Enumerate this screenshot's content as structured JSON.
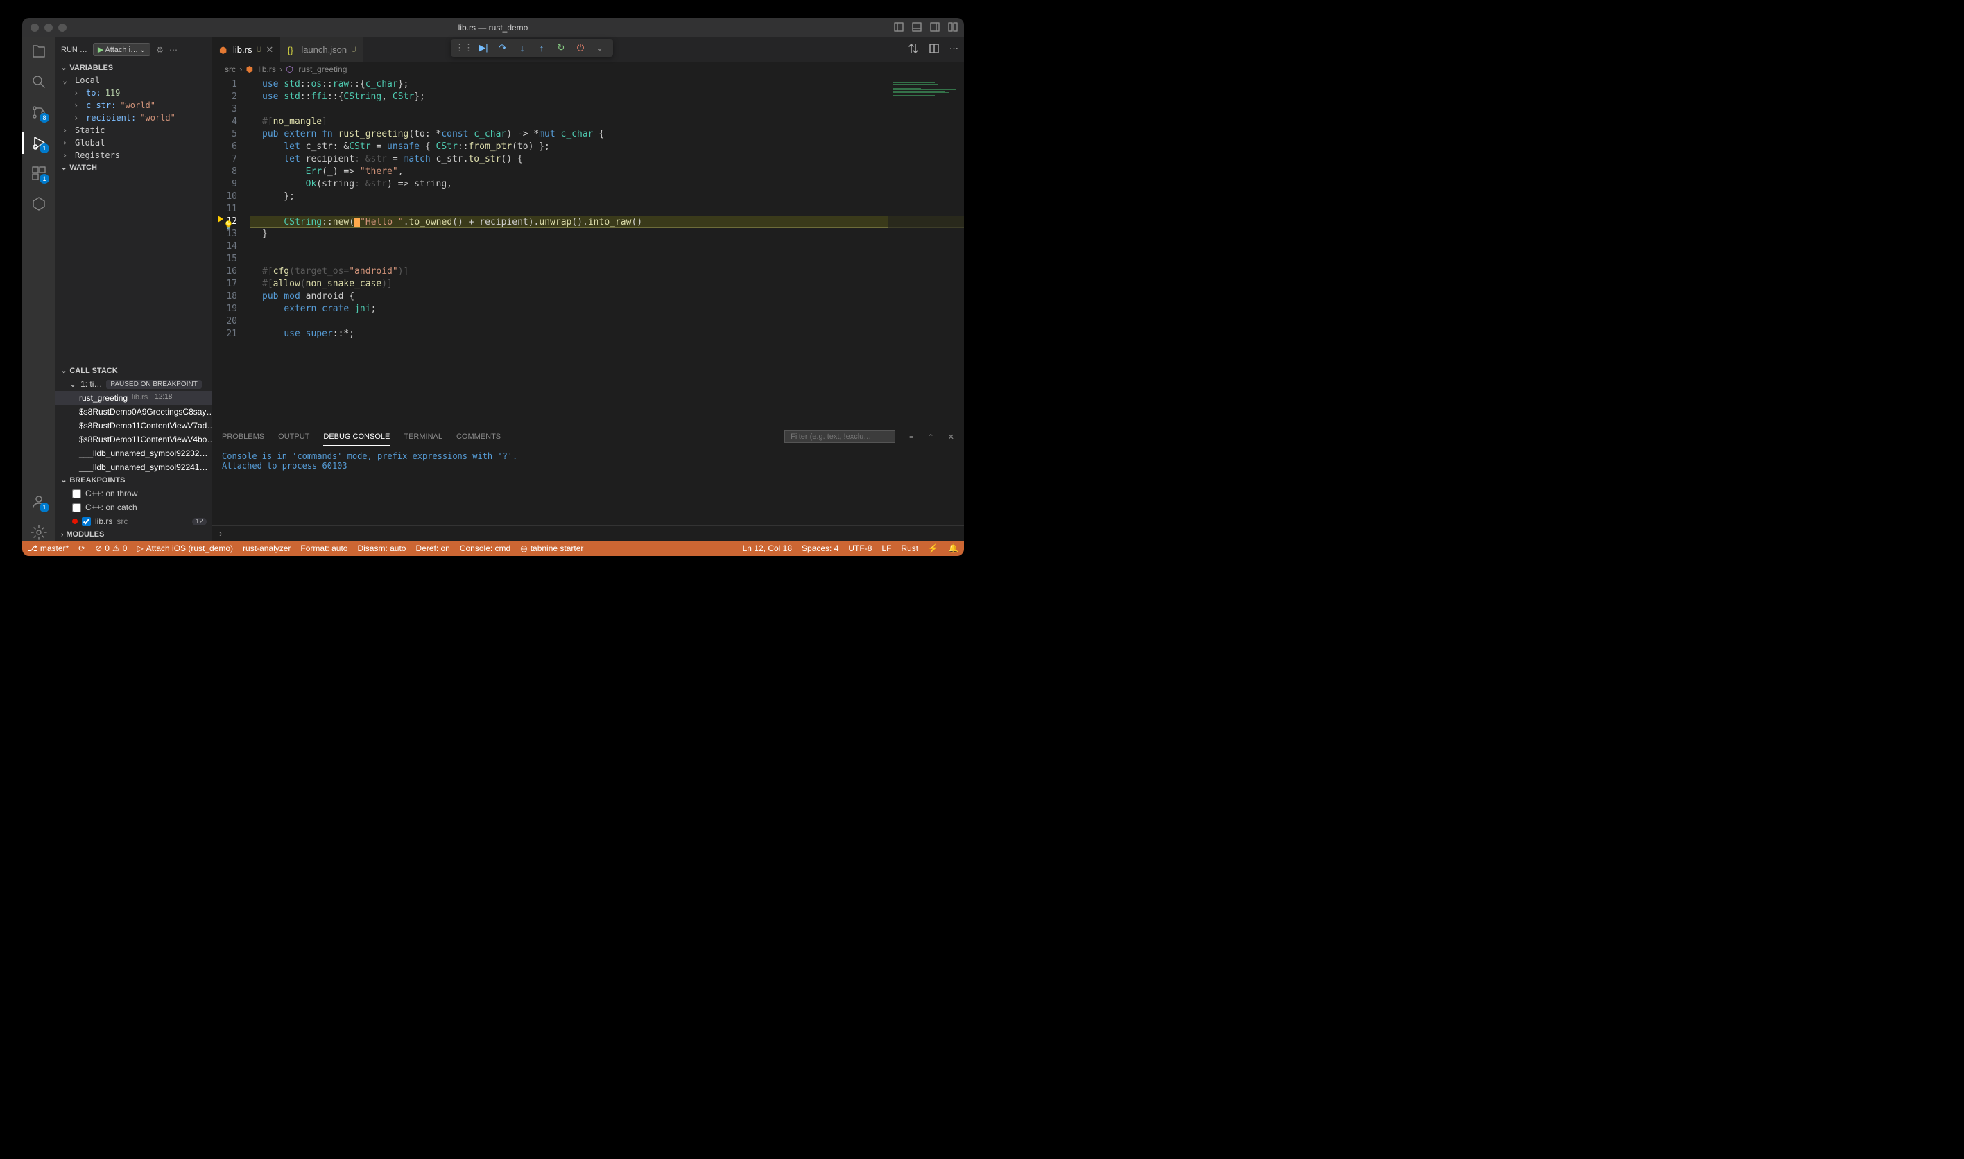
{
  "title": "lib.rs — rust_demo",
  "sidebar": {
    "title": "RUN …",
    "launchConfig": "Attach i…",
    "sections": {
      "variables": "VARIABLES",
      "watch": "WATCH",
      "callstack": "CALL STACK",
      "breakpoints": "BREAKPOINTS",
      "modules": "MODULES"
    },
    "vars": {
      "localLabel": "Local",
      "to": {
        "name": "to:",
        "value": "119"
      },
      "cstr": {
        "name": "c_str:",
        "value": "\"world\""
      },
      "recipient": {
        "name": "recipient:",
        "value": "\"world\""
      },
      "static": "Static",
      "global": "Global",
      "registers": "Registers"
    },
    "callstack": {
      "thread": "1: ti…",
      "paused": "PAUSED ON BREAKPOINT",
      "frames": [
        {
          "fn": "rust_greeting",
          "file": "lib.rs",
          "ln": "12:18"
        },
        {
          "fn": "$s8RustDemo0A9GreetingsC8say…"
        },
        {
          "fn": "$s8RustDemo11ContentViewV7ad…"
        },
        {
          "fn": "$s8RustDemo11ContentViewV4bo…"
        },
        {
          "fn": "___lldb_unnamed_symbol92232…"
        },
        {
          "fn": "___lldb_unnamed_symbol92241…"
        }
      ]
    },
    "breakpoints": [
      {
        "label": "C++: on throw",
        "checked": false
      },
      {
        "label": "C++: on catch",
        "checked": false
      },
      {
        "label": "lib.rs",
        "sub": "src",
        "checked": true,
        "dot": true,
        "ln": "12"
      }
    ]
  },
  "tabs": [
    {
      "name": "lib.rs",
      "modified": "U",
      "active": true
    },
    {
      "name": "launch.json",
      "modified": "U",
      "active": false
    }
  ],
  "breadcrumb": [
    "src",
    "lib.rs",
    "rust_greeting"
  ],
  "code": {
    "lines": [
      "use std::os::raw::{c_char};",
      "use std::ffi::{CString, CStr};",
      "",
      "#[no_mangle]",
      "pub extern fn rust_greeting(to: *const c_char) -> *mut c_char {",
      "    let c_str: &CStr = unsafe { CStr::from_ptr(to) };",
      "    let recipient: &str = match c_str.to_str() {",
      "        Err(_) => \"there\",",
      "        Ok(string: &str) => string,",
      "    };",
      "",
      "    CString::new(▯\"Hello \".to_owned() + recipient).unwrap().into_raw()",
      "}",
      "",
      "",
      "#[cfg(target_os=\"android\")]",
      "#[allow(non_snake_case)]",
      "pub mod android {",
      "    extern crate jni;",
      "",
      "    use super::*;"
    ]
  },
  "panel": {
    "tabs": [
      "PROBLEMS",
      "OUTPUT",
      "DEBUG CONSOLE",
      "TERMINAL",
      "COMMENTS"
    ],
    "active": 2,
    "filterPlaceholder": "Filter (e.g. text, !exclu…",
    "lines": [
      "Console is in 'commands' mode, prefix expressions with '?'.",
      "Attached to process 60103"
    ]
  },
  "status": {
    "branch": "master*",
    "errors": "0",
    "warnings": "0",
    "debug": "Attach iOS (rust_demo)",
    "rustAnalyzer": "rust-analyzer",
    "format": "Format: auto",
    "disasm": "Disasm: auto",
    "deref": "Deref: on",
    "console": "Console: cmd",
    "tabnine": "tabnine starter",
    "pos": "Ln 12, Col 18",
    "spaces": "Spaces: 4",
    "encoding": "UTF-8",
    "eol": "LF",
    "lang": "Rust"
  }
}
